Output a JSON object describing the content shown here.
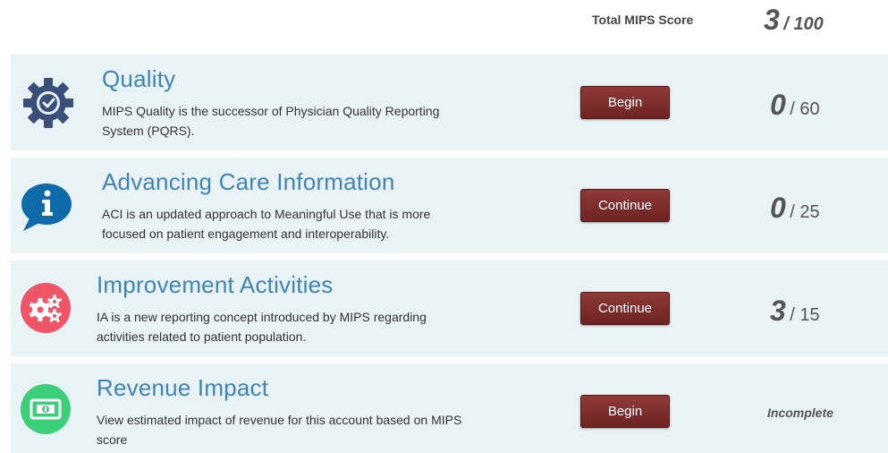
{
  "header": {
    "total_label": "Total MIPS Score",
    "total_score_value": "3",
    "total_score_max": "/ 100"
  },
  "colors": {
    "card_background": "#e9f2f5",
    "title_blue": "#3f84b8",
    "button_maroon": "#7a2b2a",
    "quality_icon": "#3a4f7a",
    "aci_icon": "#0e6aa8",
    "ia_icon": "#ef5566",
    "revenue_icon": "#3ccf7a"
  },
  "cards": [
    {
      "icon": "gear-check-icon",
      "title": "Quality",
      "desc_line1": "MIPS Quality is the successor of Physician Quality Reporting",
      "desc_line2": "System (PQRS).",
      "button": "Begin",
      "score_value": "0",
      "score_max": "/ 60"
    },
    {
      "icon": "info-speech-bubble-icon",
      "title": "Advancing Care Information",
      "desc_line1": "ACI is an updated approach to Meaningful Use that is more",
      "desc_line2": "focused on patient engagement and interoperability.",
      "button": "Continue",
      "score_value": "0",
      "score_max": "/ 25"
    },
    {
      "icon": "gears-icon",
      "title": "Improvement Activities",
      "desc_line1": "IA is a new reporting concept introduced by MIPS regarding",
      "desc_line2": "activities related to patient population.",
      "button": "Continue",
      "score_value": "3",
      "score_max": "/ 15"
    },
    {
      "icon": "money-bill-icon",
      "title": "Revenue Impact",
      "desc_line1": "View estimated impact of revenue for this account based on MIPS",
      "desc_line2": "score",
      "button": "Begin",
      "score_text": "Incomplete"
    }
  ]
}
